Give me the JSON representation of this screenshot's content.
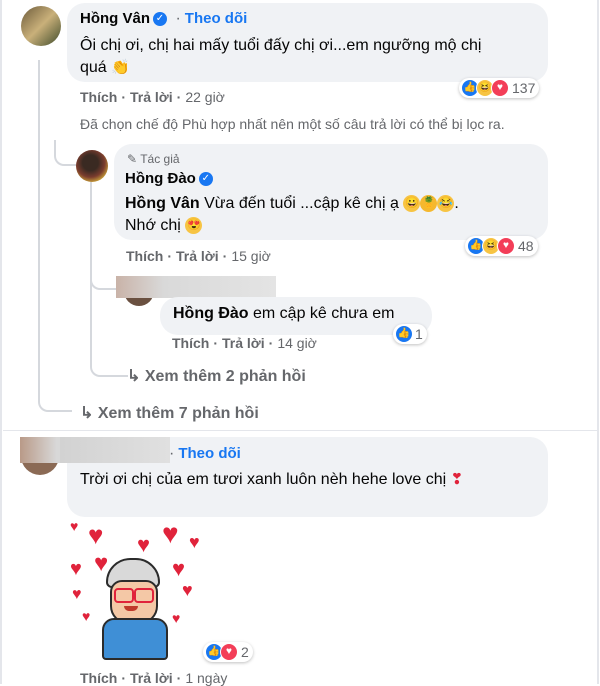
{
  "comment1": {
    "author": "Hồng Vân",
    "follow": "Theo dõi",
    "text_line1": "Ôi chị ơi, chị hai mấy tuổi đấy chị ơi...em ngưỡng mộ chị",
    "text_line2": "quá",
    "react_count": "137",
    "like": "Thích",
    "reply": "Trả lời",
    "time": "22 giờ"
  },
  "filter_note": "Đã chọn chế độ Phù hợp nhất nên một số câu trả lời có thể bị lọc ra.",
  "reply1": {
    "author_tag": "Tác giả",
    "author": "Hồng Đào",
    "mention": "Hồng Vân",
    "text_line1": "Vừa đến tuổi ...cập kê chị ạ",
    "text_line2": "Nhớ chị",
    "react_count": "48",
    "like": "Thích",
    "reply": "Trả lời",
    "time": "15 giờ"
  },
  "reply2": {
    "mention": "Hồng Đào",
    "text": "em cập kê chưa em",
    "react_count": "1",
    "like": "Thích",
    "reply": "Trả lời",
    "time": "14 giờ"
  },
  "more_replies_2": "Xem thêm 2 phản hồi",
  "more_replies_7": "Xem thêm 7 phản hồi",
  "comment2": {
    "follow": "Theo dõi",
    "text": "Trời ơi chị của em tươi xanh luôn nèh hehe love chị",
    "react_count": "2",
    "like": "Thích",
    "reply": "Trả lời",
    "time": "1 ngày"
  },
  "colors": {
    "accent": "#1877f2",
    "bubble": "#f0f2f5",
    "secondary_text": "#65676b",
    "love": "#f33e58"
  },
  "icons": {
    "arrow": "↳",
    "check": "✓",
    "pencil": "✎",
    "clap": "👏"
  }
}
